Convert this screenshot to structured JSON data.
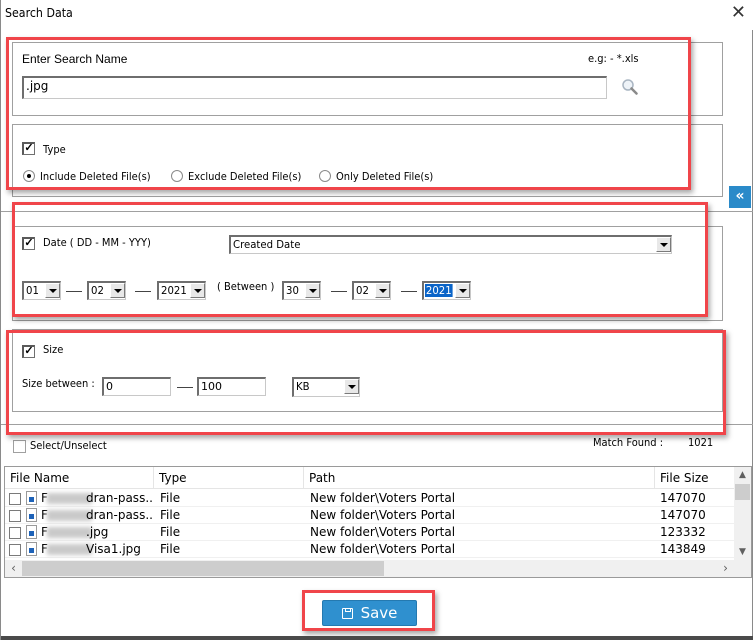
{
  "window": {
    "title": "Search Data",
    "close_glyph": "✕"
  },
  "search": {
    "label": "Enter Search Name",
    "hint": "e.g: - *.xls",
    "value": ".jpg",
    "placeholder": ""
  },
  "type_filter": {
    "checkbox_label": "Type",
    "checked": true,
    "options": [
      {
        "label": "Include Deleted File(s)",
        "selected": true
      },
      {
        "label": "Exclude Deleted File(s)",
        "selected": false
      },
      {
        "label": "Only Deleted File(s)",
        "selected": false
      }
    ]
  },
  "collapse_button": {
    "glyph": "«"
  },
  "date_filter": {
    "checkbox_label": "Date ( DD - MM - YYY)",
    "checked": true,
    "date_type": "Created Date",
    "between_label": "( Between )",
    "from": {
      "day": "01",
      "month": "02",
      "year": "2021"
    },
    "to": {
      "day": "30",
      "month": "02",
      "year": "2021"
    }
  },
  "size_filter": {
    "checkbox_label": "Size",
    "checked": true,
    "between_label": "Size between :",
    "min": "0",
    "max": "100",
    "unit": "KB"
  },
  "results": {
    "select_label": "Select/Unselect",
    "match_label": "Match Found :",
    "match_count": "1021",
    "columns": [
      "File Name",
      "Type",
      "Path",
      "File Size"
    ],
    "rows": [
      {
        "name_prefix": "F",
        "name_suffix": "dran-pass...",
        "type": "File",
        "path": "New folder\\Voters Portal",
        "size": "147070"
      },
      {
        "name_prefix": "F",
        "name_suffix": "dran-pass...",
        "type": "File",
        "path": "New folder\\Voters Portal",
        "size": "147070"
      },
      {
        "name_prefix": "F",
        "name_suffix": ".jpg",
        "type": "File",
        "path": "New folder\\Voters Portal",
        "size": "123332"
      },
      {
        "name_prefix": "F",
        "name_suffix": " Visa1.jpg",
        "type": "File",
        "path": "New folder\\Voters Portal",
        "size": "143849"
      }
    ]
  },
  "footer": {
    "save_label": "Save"
  },
  "colors": {
    "accent": "#2f90cf",
    "highlight": "#f0454a",
    "selection": "#0a64c8"
  }
}
